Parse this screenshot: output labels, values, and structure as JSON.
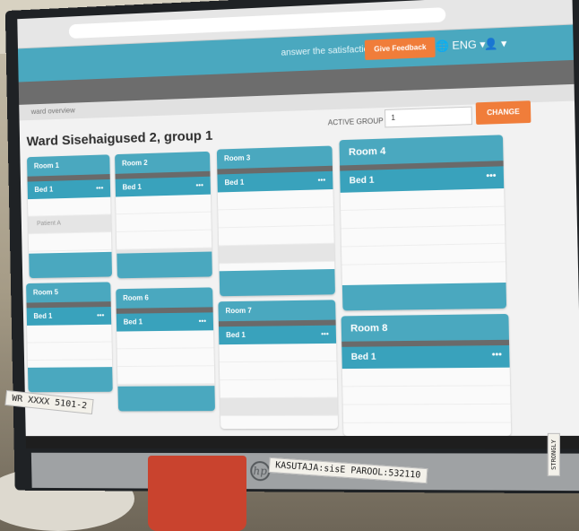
{
  "browser": {
    "url": ""
  },
  "header": {
    "prompt": "answer the satisfaction",
    "feedback_label": "Give Feedback",
    "lang_label": "🌐 ENG ▾",
    "user_label": "👤 ▾"
  },
  "subbar": {
    "logo": ""
  },
  "breadcrumb": "ward overview",
  "page_title": "Ward Sisehaigused 2, group 1",
  "group": {
    "label": "ACTIVE GROUP",
    "value": "1",
    "change_label": "CHANGE"
  },
  "rooms": [
    {
      "name": "Room 1",
      "bed": "Bed 1",
      "patients": [
        "",
        "Patient A",
        "",
        ""
      ]
    },
    {
      "name": "Room 2",
      "bed": "Bed 1",
      "patients": [
        "",
        "",
        "",
        ""
      ]
    },
    {
      "name": "Room 3",
      "bed": "Bed 1",
      "patients": [
        "",
        "",
        "",
        ""
      ]
    },
    {
      "name": "Room 4",
      "bed": "Bed 1",
      "patients": [
        "",
        "",
        "",
        ""
      ]
    },
    {
      "name": "Room 5",
      "bed": "Bed 1",
      "patients": [
        "",
        "",
        "",
        ""
      ]
    },
    {
      "name": "Room 6",
      "bed": "Bed 1",
      "patients": [
        "",
        "",
        "",
        ""
      ]
    },
    {
      "name": "Room 7",
      "bed": "Bed 1",
      "patients": [
        "",
        "",
        "",
        ""
      ]
    },
    {
      "name": "Room 8",
      "bed": "Bed 1",
      "patients": [
        "",
        "",
        "",
        ""
      ]
    }
  ],
  "taskbar": {
    "clock": ""
  },
  "labels": {
    "left_tape": "WR XXXX 5101-2",
    "right_tape": "KASUTAJA:sisE PAROOL:532110",
    "side_tape": "STRONGLY"
  },
  "colors": {
    "accent": "#4aa8bf",
    "orange": "#f07d3a",
    "dark_bar": "#6d6d6d"
  }
}
